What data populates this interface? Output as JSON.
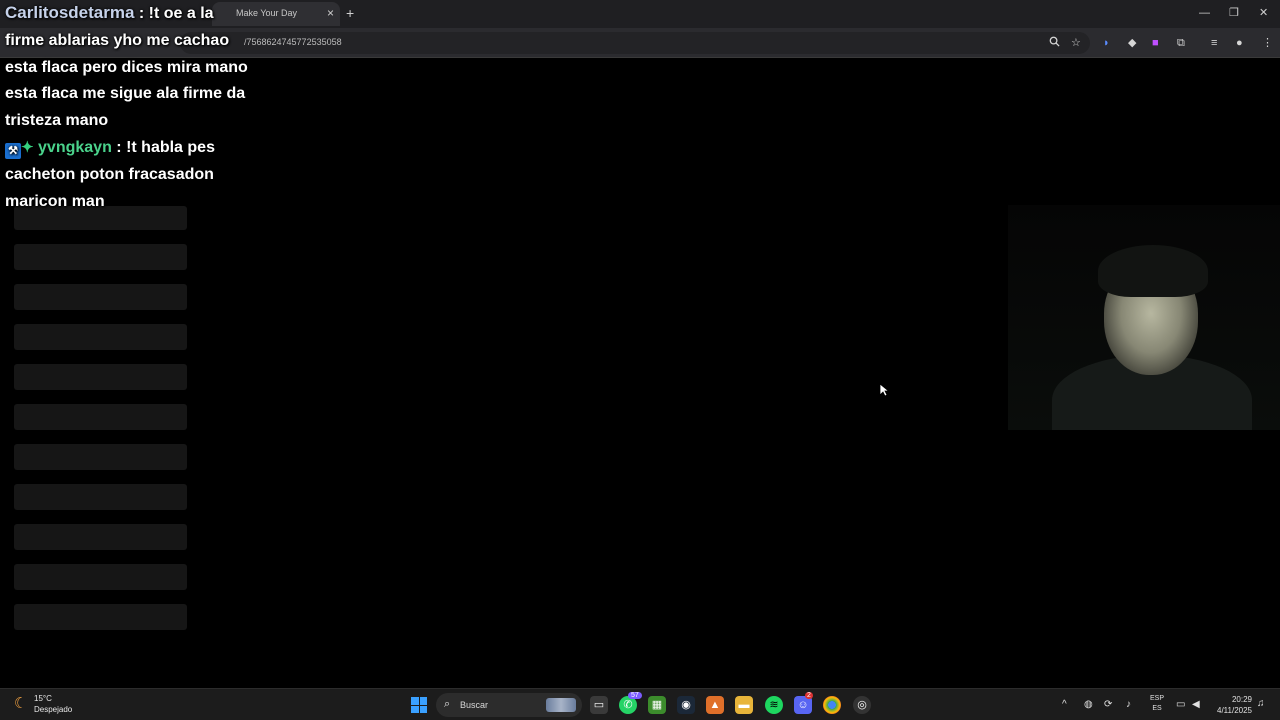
{
  "browser": {
    "tab_title": "Make Your Day",
    "url": "/7568624745772535058",
    "new_tab": "+",
    "tab_close": "×",
    "window_controls": {
      "minimize": "—",
      "maximize": "❐",
      "close": "✕"
    },
    "toolbar_icons": [
      "zoom-icon",
      "bookmark-star-icon",
      "extension-icon",
      "extension-icon",
      "extension-icon",
      "puzzle-icon",
      "media-icon",
      "profile-icon",
      "menu-icon"
    ]
  },
  "chat": {
    "messages": [
      {
        "user": "Carlitosdetarma",
        "separator": " : ",
        "text": "!t oe a la firme ablarias yho me cachao esta flaca pero dices mira mano esta flaca me sigue ala firme da tristeza mano"
      },
      {
        "user": "yvngkayn",
        "separator": " : ",
        "text": "!t habla pes cacheton poton fracasadon maricon man",
        "badges": [
          "badge-icon",
          "sparkle-icon"
        ]
      }
    ]
  },
  "taskbar": {
    "weather": {
      "temp": "15°C",
      "condition": "Despejado"
    },
    "search_label": "Buscar",
    "apps": [
      "task-view-icon",
      "whatsapp-icon",
      "minecraft-icon",
      "steam-icon",
      "app-icon",
      "file-explorer-icon",
      "spotify-icon",
      "discord-icon",
      "chrome-icon",
      "obs-icon"
    ],
    "language": {
      "top": "ESP",
      "bottom": "ES"
    },
    "time": "20:29",
    "date": "4/11/2025",
    "badges": {
      "whatsapp": "57",
      "discord": "2"
    }
  }
}
